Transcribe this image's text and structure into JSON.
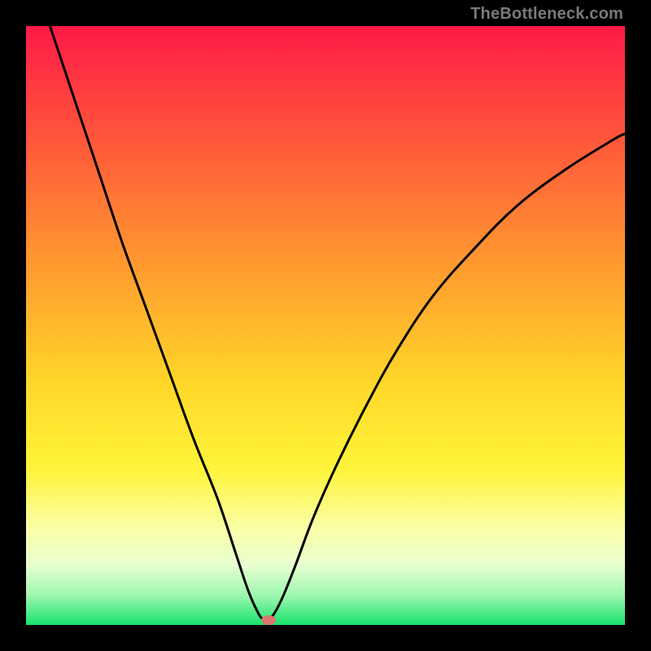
{
  "attribution": "TheBottleneck.com",
  "chart_data": {
    "type": "line",
    "title": "",
    "xlabel": "",
    "ylabel": "",
    "xlim": [
      0,
      100
    ],
    "ylim": [
      0,
      100
    ],
    "grid": false,
    "series": [
      {
        "name": "bottleneck-curve",
        "x": [
          4,
          8,
          12,
          16,
          20,
          24,
          28,
          32,
          35,
          37,
          38.5,
          39.5,
          40.5,
          41.5,
          43,
          45,
          48,
          52,
          57,
          62,
          68,
          75,
          82,
          90,
          98,
          100
        ],
        "y": [
          100,
          88,
          76,
          64,
          53,
          42,
          31,
          21,
          12,
          6,
          2.5,
          1,
          1,
          2,
          5,
          10,
          18,
          27,
          37,
          46,
          55,
          63,
          70,
          76,
          81,
          82
        ]
      }
    ],
    "minimum_marker": {
      "x": 40.5,
      "y": 0.8
    },
    "gradient_stops": [
      {
        "offset": 0.0,
        "color": "#ff1a47"
      },
      {
        "offset": 0.2,
        "color": "#ff5a3a"
      },
      {
        "offset": 0.4,
        "color": "#ff9a2f"
      },
      {
        "offset": 0.6,
        "color": "#ffd829"
      },
      {
        "offset": 0.74,
        "color": "#fff43a"
      },
      {
        "offset": 0.84,
        "color": "#faffa8"
      },
      {
        "offset": 0.9,
        "color": "#e8ffd0"
      },
      {
        "offset": 0.95,
        "color": "#9ff7b0"
      },
      {
        "offset": 1.0,
        "color": "#17e36c"
      }
    ]
  }
}
